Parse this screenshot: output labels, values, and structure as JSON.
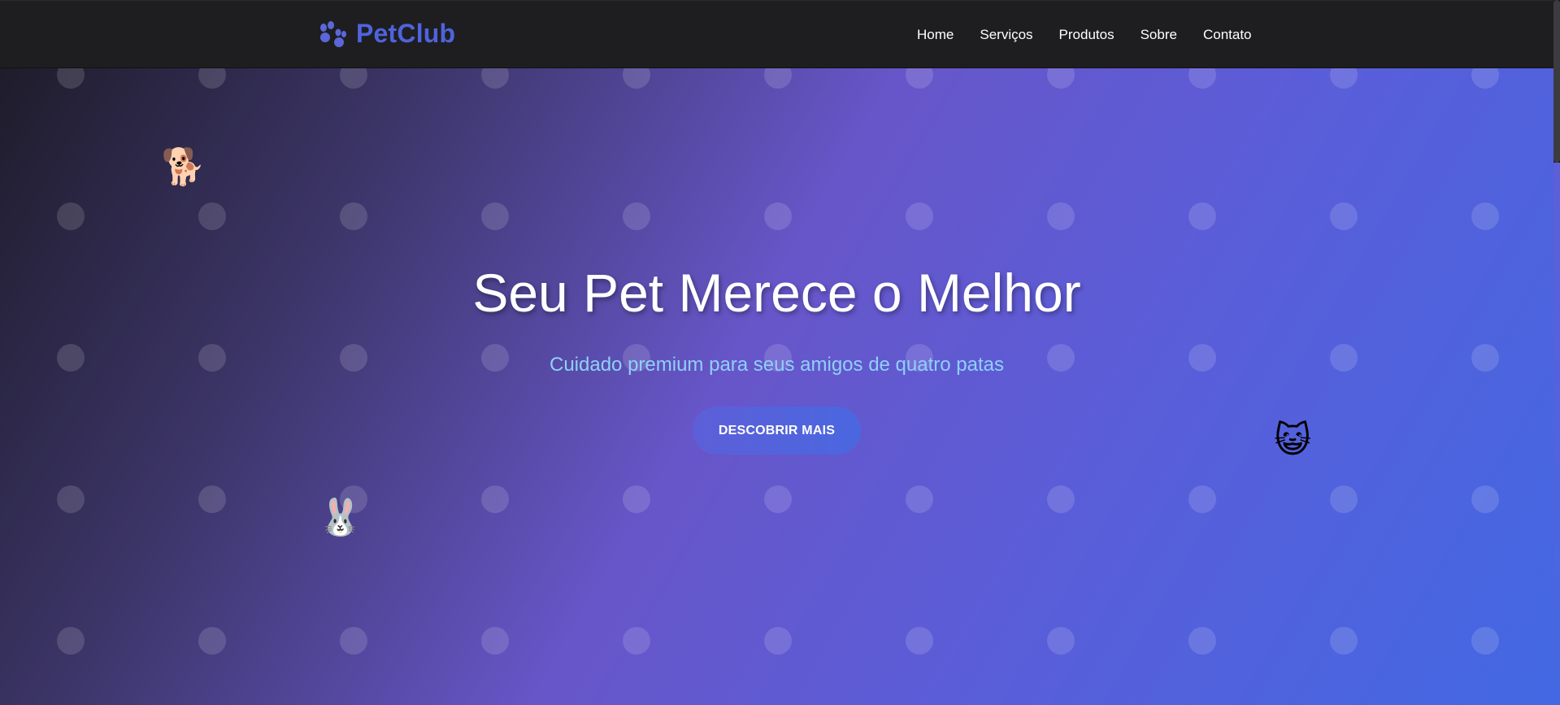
{
  "brand": {
    "name": "PetClub",
    "icon": "paw-icon",
    "color": "#4f63dc"
  },
  "nav": {
    "items": [
      {
        "label": "Home"
      },
      {
        "label": "Serviços"
      },
      {
        "label": "Produtos"
      },
      {
        "label": "Sobre"
      },
      {
        "label": "Contato"
      }
    ]
  },
  "hero": {
    "title": "Seu Pet Merece o Melhor",
    "subtitle": "Cuidado premium para seus amigos de quatro patas",
    "cta_label": "DESCOBRIR MAIS",
    "pets": [
      {
        "icon": "dog-icon",
        "glyph": "🐕"
      },
      {
        "icon": "cat-icon",
        "glyph": "😺"
      },
      {
        "icon": "rabbit-icon",
        "glyph": "🐰"
      }
    ]
  },
  "colors": {
    "topbar_bg": "#1e1e21",
    "subtitle": "#8fd0f7",
    "accent_blue": "#4368e3",
    "accent_purple": "#6756c9"
  }
}
